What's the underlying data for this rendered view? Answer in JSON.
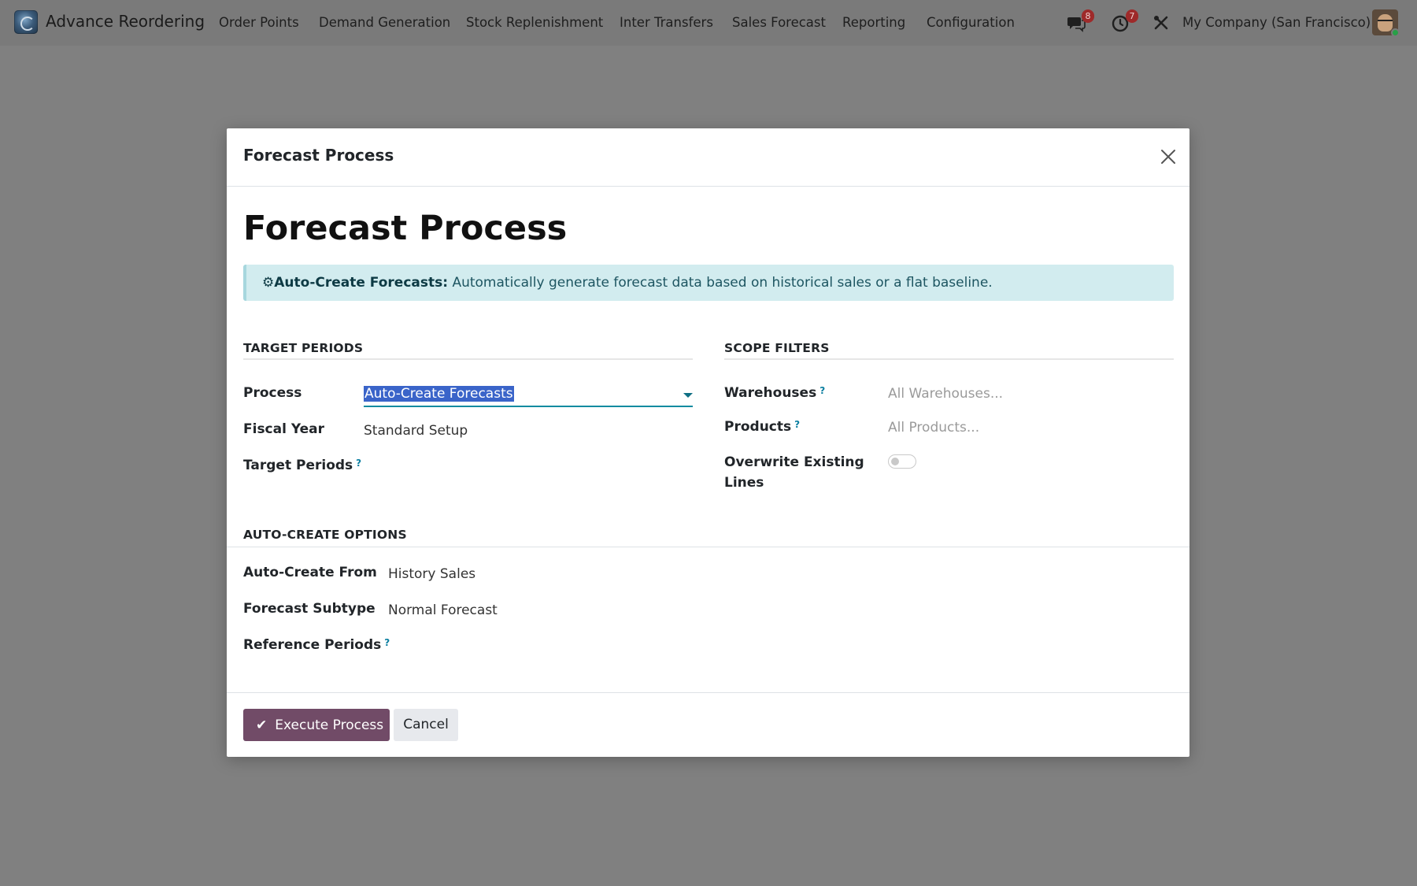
{
  "navbar": {
    "app_name": "Advance Reordering",
    "menu": [
      {
        "label": "Order Points"
      },
      {
        "label": "Demand Generation"
      },
      {
        "label": "Stock Replenishment"
      },
      {
        "label": "Inter Transfers"
      },
      {
        "label": "Sales Forecast"
      },
      {
        "label": "Reporting"
      },
      {
        "label": "Configuration"
      }
    ],
    "messages_count": "8",
    "activities_count": "7",
    "company": "My Company (San Francisco)"
  },
  "modal": {
    "header_title": "Forecast Process",
    "title": "Forecast Process",
    "alert": {
      "icon": "⚙",
      "strong": "Auto-Create Forecasts:",
      "text": "Automatically generate forecast data based on historical sales or a flat baseline."
    },
    "target_periods": {
      "heading": "TARGET PERIODS",
      "process_label": "Process",
      "process_value": "Auto-Create Forecasts",
      "fiscal_year_label": "Fiscal Year",
      "fiscal_year_value": "Standard Setup",
      "target_periods_label": "Target Periods"
    },
    "scope_filters": {
      "heading": "SCOPE FILTERS",
      "warehouses_label": "Warehouses",
      "warehouses_placeholder": "All Warehouses...",
      "products_label": "Products",
      "products_placeholder": "All Products...",
      "overwrite_label_line1": "Overwrite Existing",
      "overwrite_label_line2": "Lines",
      "overwrite_enabled": false
    },
    "auto_create": {
      "heading": "AUTO-CREATE OPTIONS",
      "from_label": "Auto-Create From",
      "from_value": "History Sales",
      "subtype_label": "Forecast Subtype",
      "subtype_value": "Normal Forecast",
      "reference_label": "Reference Periods"
    },
    "footer": {
      "execute_label": "Execute Process",
      "cancel_label": "Cancel"
    },
    "help_marker": "?"
  },
  "colors": {
    "primary": "#714b67",
    "accent": "#0f8ba0",
    "alert_bg": "#d2ecef",
    "badge": "#9e2a2a"
  }
}
